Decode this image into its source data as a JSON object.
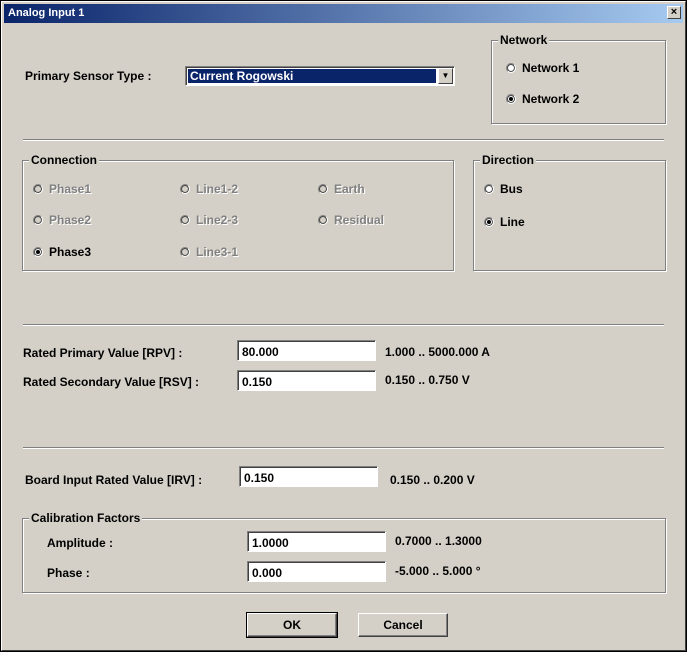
{
  "window": {
    "title": "Analog Input 1",
    "close_glyph": "×"
  },
  "sensor": {
    "label": "Primary Sensor Type :",
    "selected": "Current Rogowski",
    "dropdown_icon": "chevron-down-icon"
  },
  "network": {
    "caption": "Network",
    "options": [
      {
        "label": "Network 1",
        "checked": false
      },
      {
        "label": "Network 2",
        "checked": true
      }
    ]
  },
  "connection": {
    "caption": "Connection",
    "options": [
      {
        "label": "Phase1",
        "enabled": false,
        "checked": false
      },
      {
        "label": "Phase2",
        "enabled": false,
        "checked": false
      },
      {
        "label": "Phase3",
        "enabled": true,
        "checked": true
      },
      {
        "label": "Line1-2",
        "enabled": false,
        "checked": false
      },
      {
        "label": "Line2-3",
        "enabled": false,
        "checked": false
      },
      {
        "label": "Line3-1",
        "enabled": false,
        "checked": false
      },
      {
        "label": "Earth",
        "enabled": false,
        "checked": false
      },
      {
        "label": "Residual",
        "enabled": false,
        "checked": false
      }
    ]
  },
  "direction": {
    "caption": "Direction",
    "options": [
      {
        "label": "Bus",
        "checked": false
      },
      {
        "label": "Line",
        "checked": true
      }
    ]
  },
  "rated": {
    "rpv": {
      "label": "Rated Primary Value [RPV] :",
      "value": "80.000",
      "range": "1.000 .. 5000.000 A"
    },
    "rsv": {
      "label": "Rated Secondary Value [RSV] :",
      "value": "0.150",
      "range": "0.150 .. 0.750 V"
    }
  },
  "board": {
    "label": "Board Input Rated Value [IRV] :",
    "value": "0.150",
    "range": "0.150 .. 0.200 V"
  },
  "calibration": {
    "caption": "Calibration Factors",
    "amplitude": {
      "label": "Amplitude :",
      "value": "1.0000",
      "range": "0.7000 .. 1.3000"
    },
    "phase": {
      "label": "Phase :",
      "value": "0.000",
      "range": "-5.000 .. 5.000 °"
    }
  },
  "buttons": {
    "ok": "OK",
    "cancel": "Cancel"
  }
}
